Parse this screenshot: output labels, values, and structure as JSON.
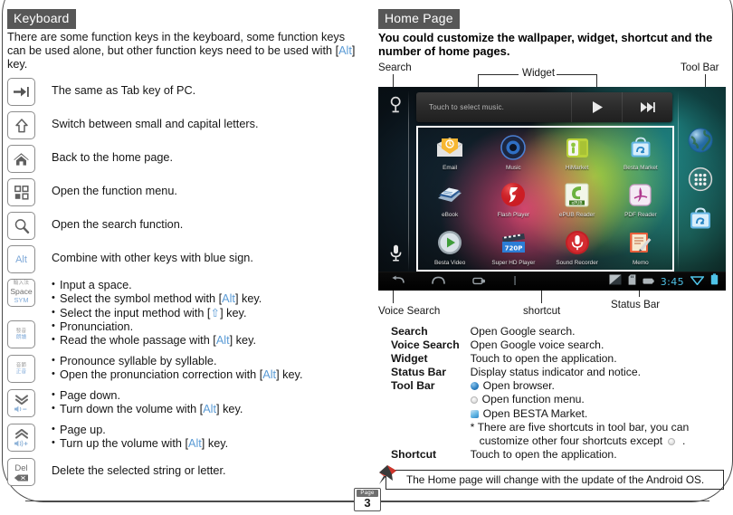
{
  "left_panel": {
    "tag": "Keyboard",
    "intro_before": "There are some function keys in the keyboard, some function keys can be used alone, but other function keys need to be used with ",
    "intro_alt": "Alt",
    "intro_after": " key.",
    "keys": [
      {
        "name": "tab-key",
        "glyph": "tab-arrow-icon",
        "lines": [
          "The same as Tab key of PC."
        ]
      },
      {
        "name": "shift-key",
        "glyph": "shift-arrow-icon",
        "lines": [
          "Switch between small and capital letters."
        ]
      },
      {
        "name": "home-key",
        "glyph": "home-icon",
        "lines": [
          "Back to the home page."
        ]
      },
      {
        "name": "menu-key",
        "glyph": "grid-menu-icon",
        "lines": [
          "Open the function menu."
        ]
      },
      {
        "name": "search-key",
        "glyph": "magnifier-icon",
        "lines": [
          "Open the search function."
        ]
      },
      {
        "name": "alt-key",
        "glyph": "alt-label",
        "cap_text": "Alt",
        "lines": [
          "Combine with other keys with blue sign."
        ]
      },
      {
        "name": "space-key",
        "glyph": "space-sym-label",
        "cap_top": "輸入法",
        "cap_mid": "Space",
        "cap_bot": "SYM",
        "bullets": [
          {
            "pre": "Input a space.",
            "key": "",
            "post": ""
          },
          {
            "pre": "Select the symbol method with ",
            "key": "Alt",
            "post": " key."
          },
          {
            "pre": "Select the input method with ",
            "key": "⇧",
            "post": " key."
          }
        ]
      },
      {
        "name": "pronunciation-key",
        "glyph": "pronounce-label",
        "cap_top": "發音",
        "cap_bot": "朗讀",
        "bullets": [
          {
            "pre": "Pronunciation.",
            "key": "",
            "post": ""
          },
          {
            "pre": "Read the whole passage with ",
            "key": "Alt",
            "post": " key."
          }
        ]
      },
      {
        "name": "syllable-key",
        "glyph": "syllable-label",
        "cap_top": "音節",
        "cap_bot": "正音",
        "bullets": [
          {
            "pre": "Pronounce syllable by syllable.",
            "key": "",
            "post": ""
          },
          {
            "pre": "Open the pronunciation correction with ",
            "key": "Alt",
            "post": " key."
          }
        ]
      },
      {
        "name": "page-down-key",
        "glyph": "double-chevron-down-volume-down-icon",
        "bullets": [
          {
            "pre": "Page down.",
            "key": "",
            "post": ""
          },
          {
            "pre": "Turn down the volume with ",
            "key": "Alt",
            "post": " key."
          }
        ]
      },
      {
        "name": "page-up-key",
        "glyph": "double-chevron-up-volume-up-icon",
        "bullets": [
          {
            "pre": "Page up.",
            "key": "",
            "post": ""
          },
          {
            "pre": "Turn up the volume with ",
            "key": "Alt",
            "post": " key."
          }
        ]
      },
      {
        "name": "delete-key",
        "glyph": "del-backspace-icon",
        "cap_text": "Del",
        "lines": [
          "Delete the selected string or letter."
        ]
      }
    ]
  },
  "right_panel": {
    "tag": "Home Page",
    "headline": "You could customize the wallpaper, widget, shortcut and the number of home pages.",
    "callouts": {
      "search": "Search",
      "widget": "Widget",
      "toolbar": "Tool Bar",
      "voice_search": "Voice Search",
      "shortcut": "shortcut",
      "status_bar": "Status Bar"
    },
    "tablet": {
      "music_widget": {
        "title": "Touch to select music.",
        "play_icon": "play-icon",
        "next_icon": "next-track-icon"
      },
      "apps": [
        {
          "label": "Email",
          "icon": "email-icon"
        },
        {
          "label": "Music",
          "icon": "music-icon"
        },
        {
          "label": "HiMarket",
          "icon": "himarket-icon"
        },
        {
          "label": "Besta Market",
          "icon": "besta-market-icon"
        },
        {
          "label": "eBook",
          "icon": "ebook-icon"
        },
        {
          "label": "Flash Player",
          "icon": "flash-player-icon"
        },
        {
          "label": "ePUB Reader",
          "icon": "epub-reader-icon"
        },
        {
          "label": "PDF Reader",
          "icon": "pdf-reader-icon"
        },
        {
          "label": "Besta Video",
          "icon": "besta-video-icon"
        },
        {
          "label": "Super HD Player",
          "icon": "super-hd-player-icon"
        },
        {
          "label": "Sound Recorder",
          "icon": "sound-recorder-icon"
        },
        {
          "label": "Memo",
          "icon": "memo-icon"
        }
      ],
      "toolbar_icons": [
        {
          "name": "browser-globe-icon"
        },
        {
          "name": "app-drawer-icon"
        },
        {
          "name": "besta-market-bag-icon"
        }
      ],
      "status_bar": {
        "clock": "3:45",
        "back_icon": "back-icon",
        "home_icon": "home-icon",
        "recents_icon": "recents-icon",
        "wifi_icon": "wifi-icon",
        "battery_icon": "battery-icon"
      }
    },
    "legend": [
      {
        "key": "Search",
        "value": "Open Google search."
      },
      {
        "key": "Voice Search",
        "value": "Open Google voice search."
      },
      {
        "key": "Widget",
        "value": "Touch to open the application."
      },
      {
        "key": "Status Bar",
        "value": "Display status indicator and notice."
      }
    ],
    "toolbar_legend": {
      "key": "Tool Bar",
      "items": [
        {
          "dot": "browser",
          "text": "Open browser."
        },
        {
          "dot": "menu",
          "text": "Open function menu."
        },
        {
          "dot": "market",
          "text": "Open BESTA Market."
        }
      ],
      "note_pre": "* There are five shortcuts in tool bar, you can customize other four shortcuts except ",
      "note_post": " ."
    },
    "shortcut_legend": {
      "key": "Shortcut",
      "value": "Touch to open the application."
    },
    "note": "The Home page will change with the update of the Android OS."
  },
  "page_badge": {
    "word": "Page",
    "number": "3"
  }
}
